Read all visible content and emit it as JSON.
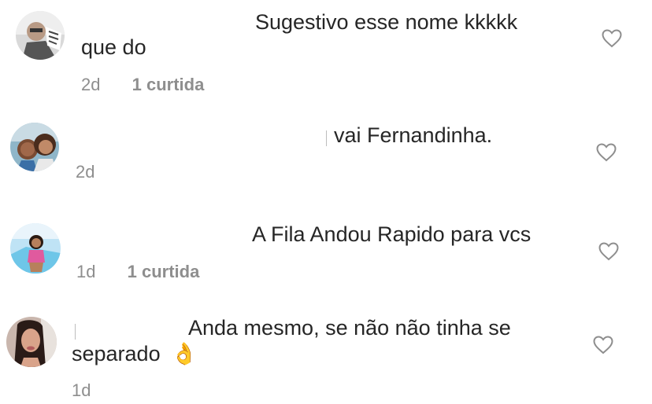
{
  "comments": [
    {
      "line1": "Sugestivo esse nome kkkkk",
      "line2": "que do",
      "time": "2d",
      "likes": "1 curtida",
      "avatar_icon": "man-with-glasses-avatar-icon",
      "like_icon": "heart-outline-icon"
    },
    {
      "line1": "vai Fernandinha.",
      "time": "2d",
      "avatar_icon": "two-girls-selfie-avatar-icon",
      "like_icon": "heart-outline-icon"
    },
    {
      "line1": "A Fila Andou Rapido para vcs",
      "time": "1d",
      "likes": "1 curtida",
      "avatar_icon": "girl-in-pink-avatar-icon",
      "like_icon": "heart-outline-icon"
    },
    {
      "line1": "Anda mesmo, se não não tinha se",
      "line2": "separado",
      "emoji": "👌",
      "time": "1d",
      "avatar_icon": "woman-portrait-avatar-icon",
      "like_icon": "heart-outline-icon"
    }
  ],
  "colors": {
    "text": "#262626",
    "meta": "#8e8e8e",
    "icon": "#8e8e8e",
    "background": "#ffffff"
  }
}
